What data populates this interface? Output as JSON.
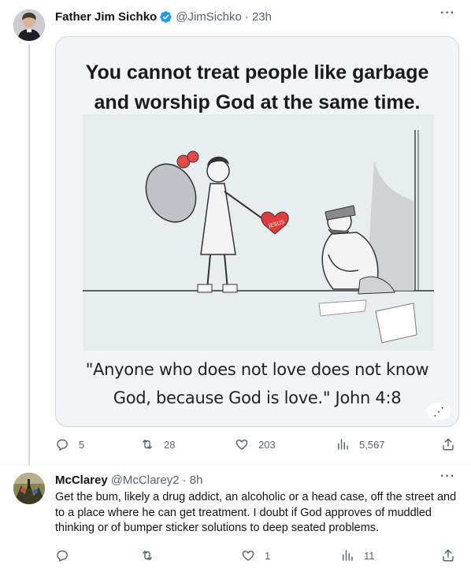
{
  "tweets": [
    {
      "author_name": "Father Jim Sichko",
      "handle": "@JimSichko",
      "time": "· 23h",
      "verified": true,
      "more_label": "···",
      "media": {
        "headline_line1": "You cannot  treat people like garbage",
        "headline_line2": "and worship God at the same time.",
        "heart_label": "JESUS",
        "quote_line1": "\"Anyone who does not love does not know",
        "quote_line2": "God, because God is love.\" John 4:8",
        "alt_badge": "⋰"
      },
      "stats": {
        "replies": "5",
        "retweets": "28",
        "likes": "203",
        "views": "5,567"
      }
    },
    {
      "author_name": "McClarey",
      "handle": "@McClarey2",
      "time": "· 8h",
      "more_label": "···",
      "text": "Get the bum, likely a drug addict, an alcoholic or a head case, off the street and to a place where he can get treatment.  I doubt if God approves of muddled thinking or of bumper sticker solutions to deep seated problems.",
      "stats": {
        "replies": "",
        "retweets": "",
        "likes": "1",
        "views": "11"
      }
    }
  ],
  "icons": [
    "reply-icon",
    "retweet-icon",
    "like-icon",
    "views-icon",
    "share-icon",
    "verified-badge-icon",
    "more-icon"
  ],
  "colors": {
    "verified": "#1d9bf0",
    "secondary_text": "#536471",
    "primary_text": "#0f1419",
    "divider": "#cfd9de"
  }
}
